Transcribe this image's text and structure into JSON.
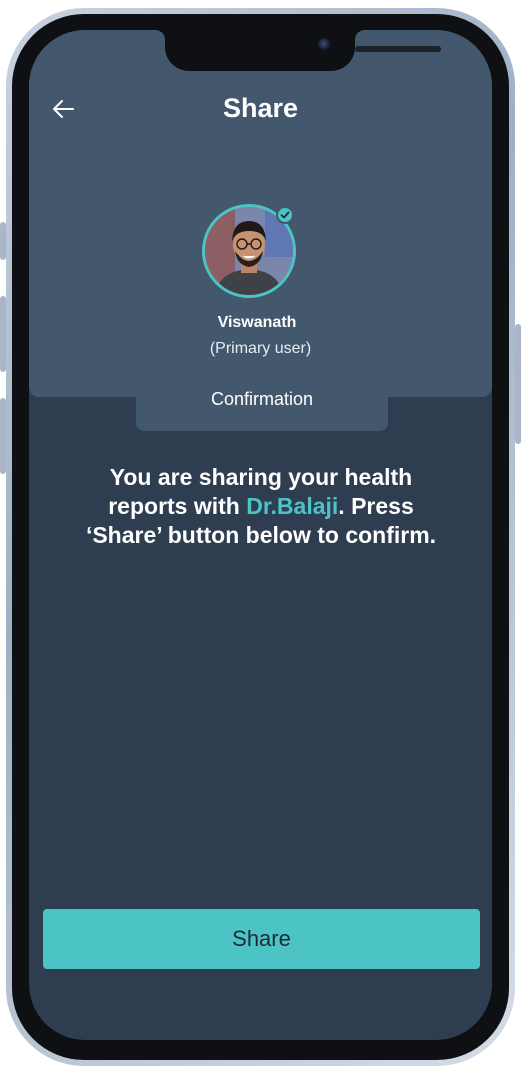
{
  "header": {
    "title": "Share",
    "back_icon": "arrow-left-icon"
  },
  "profile": {
    "name": "Viswanath",
    "role": "(Primary user)",
    "verified_icon": "check-circle-icon"
  },
  "tab": {
    "label": "Confirmation"
  },
  "confirmation_message": {
    "before": "You are sharing your health reports with ",
    "doctor": "Dr.Balaji",
    "after": ". Press ‘Share’ button below to confirm."
  },
  "actions": {
    "share_label": "Share"
  },
  "colors": {
    "accent": "#4cc3c4",
    "header_bg": "#43576d",
    "screen_bg": "#2e3d50"
  }
}
